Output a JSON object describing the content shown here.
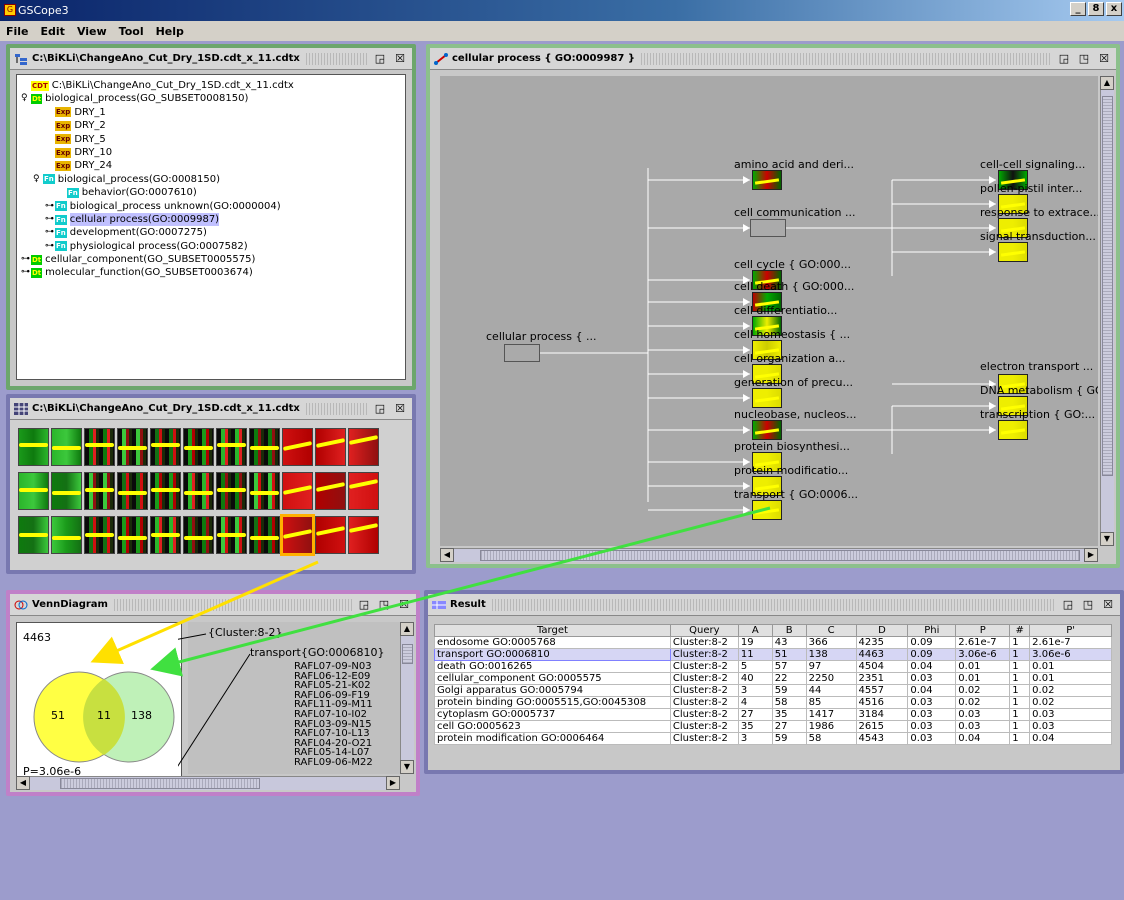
{
  "app": {
    "title": "GSCope3",
    "window_buttons": [
      "_",
      "8",
      "x"
    ]
  },
  "menu": [
    "File",
    "Edit",
    "View",
    "Tool",
    "Help"
  ],
  "tree_window": {
    "title": "C:\\BiKLi\\ChangeAno_Cut_Dry_1SD.cdt_x_11.cdtx",
    "nodes": [
      {
        "tag": "cdt",
        "tag_text": "CDT",
        "label": "C:\\BiKLi\\ChangeAno_Cut_Dry_1SD.cdt_x_11.cdtx",
        "indent": 0,
        "toggle": ""
      },
      {
        "tag": "dt",
        "tag_text": "Dt",
        "label": "biological_process(GO_SUBSET0008150)",
        "indent": 0,
        "toggle": "o"
      },
      {
        "tag": "exp",
        "tag_text": "Exp",
        "label": "DRY_1",
        "indent": 2,
        "toggle": ""
      },
      {
        "tag": "exp",
        "tag_text": "Exp",
        "label": "DRY_2",
        "indent": 2,
        "toggle": ""
      },
      {
        "tag": "exp",
        "tag_text": "Exp",
        "label": "DRY_5",
        "indent": 2,
        "toggle": ""
      },
      {
        "tag": "exp",
        "tag_text": "Exp",
        "label": "DRY_10",
        "indent": 2,
        "toggle": ""
      },
      {
        "tag": "exp",
        "tag_text": "Exp",
        "label": "DRY_24",
        "indent": 2,
        "toggle": ""
      },
      {
        "tag": "fn",
        "tag_text": "Fn",
        "label": "biological_process(GO:0008150)",
        "indent": 1,
        "toggle": "o"
      },
      {
        "tag": "fn",
        "tag_text": "Fn",
        "label": "behavior(GO:0007610)",
        "indent": 3,
        "toggle": ""
      },
      {
        "tag": "fn",
        "tag_text": "Fn",
        "label": "biological_process unknown(GO:0000004)",
        "indent": 2,
        "toggle": "o-"
      },
      {
        "tag": "fn",
        "tag_text": "Fn",
        "label": "cellular process(GO:0009987)",
        "indent": 2,
        "toggle": "o-",
        "selected": true
      },
      {
        "tag": "fn",
        "tag_text": "Fn",
        "label": "development(GO:0007275)",
        "indent": 2,
        "toggle": "o-"
      },
      {
        "tag": "fn",
        "tag_text": "Fn",
        "label": "physiological process(GO:0007582)",
        "indent": 2,
        "toggle": "o-"
      },
      {
        "tag": "dt",
        "tag_text": "Dt",
        "label": "cellular_component(GO_SUBSET0005575)",
        "indent": 0,
        "toggle": "o-"
      },
      {
        "tag": "dt",
        "tag_text": "Dt",
        "label": "molecular_function(GO_SUBSET0003674)",
        "indent": 0,
        "toggle": "o-"
      }
    ]
  },
  "cluster_window": {
    "title": "C:\\BiKLi\\ChangeAno_Cut_Dry_1SD.cdt_x_11.cdtx"
  },
  "graph_window": {
    "title": "cellular process { GO:0009987 }",
    "root_label": "cellular process { ...",
    "level1": [
      "amino acid and deri...",
      "cell communication ...",
      "cell cycle { GO:000...",
      "cell death { GO:000...",
      "cell differentiatio...",
      "cell homeostasis { ...",
      "cell organization a...",
      "generation of precu...",
      "nucleobase, nucleos...",
      "protein biosynthesi...",
      "protein modificatio...",
      "transport { GO:0006..."
    ],
    "level2_comm": [
      "cell-cell signaling...",
      "pollen-pistil inter...",
      "response to extrace...",
      "signal transduction..."
    ],
    "level2_nucleo": [
      "electron transport ...",
      "DNA metabolism { GO",
      "transcription { GO:..."
    ]
  },
  "venn_window": {
    "title": "VennDiagram",
    "total": "4463",
    "left_only": "51",
    "overlap": "11",
    "right_only": "138",
    "pvalue": "P=3.06e-6",
    "label_cluster": "{Cluster:8-2}",
    "label_transport": "transport{GO:0006810}",
    "genes": [
      "RAFL07-09-N03",
      "RAFL06-12-E09",
      "RAFL05-21-K02",
      "RAFL06-09-F19",
      "RAFL11-09-M11",
      "RAFL07-10-I02",
      "RAFL03-09-N15",
      "RAFL07-10-L13",
      "RAFL04-20-O21",
      "RAFL05-14-L07",
      "RAFL09-06-M22"
    ]
  },
  "result_window": {
    "title": "Result",
    "columns": [
      "Target",
      "Query",
      "A",
      "B",
      "C",
      "D",
      "Phi",
      "P",
      "#",
      "P'"
    ],
    "rows": [
      [
        "endosome GO:0005768",
        "Cluster:8-2",
        "19",
        "43",
        "366",
        "4235",
        "0.09",
        "2.61e-7",
        "1",
        "2.61e-7"
      ],
      [
        "transport GO:0006810",
        "Cluster:8-2",
        "11",
        "51",
        "138",
        "4463",
        "0.09",
        "3.06e-6",
        "1",
        "3.06e-6"
      ],
      [
        "death GO:0016265",
        "Cluster:8-2",
        "5",
        "57",
        "97",
        "4504",
        "0.04",
        "0.01",
        "1",
        "0.01"
      ],
      [
        "cellular_component GO:0005575",
        "Cluster:8-2",
        "40",
        "22",
        "2250",
        "2351",
        "0.03",
        "0.01",
        "1",
        "0.01"
      ],
      [
        "Golgi apparatus GO:0005794",
        "Cluster:8-2",
        "3",
        "59",
        "44",
        "4557",
        "0.04",
        "0.02",
        "1",
        "0.02"
      ],
      [
        "protein binding GO:0005515,GO:0045308",
        "Cluster:8-2",
        "4",
        "58",
        "85",
        "4516",
        "0.03",
        "0.02",
        "1",
        "0.02"
      ],
      [
        "cytoplasm GO:0005737",
        "Cluster:8-2",
        "27",
        "35",
        "1417",
        "3184",
        "0.03",
        "0.03",
        "1",
        "0.03"
      ],
      [
        "cell GO:0005623",
        "Cluster:8-2",
        "35",
        "27",
        "1986",
        "2615",
        "0.03",
        "0.03",
        "1",
        "0.03"
      ],
      [
        "protein modification GO:0006464",
        "Cluster:8-2",
        "3",
        "59",
        "58",
        "4543",
        "0.03",
        "0.04",
        "1",
        "0.04"
      ]
    ],
    "highlight_row": 1
  },
  "colors": {
    "tree_frame": "#6ca66c",
    "graph_frame": "#8cc08c",
    "cluster_frame": "#7878b0",
    "venn_frame": "#c080c8",
    "result_frame": "#7878b0",
    "desktop": "#9c9ccc",
    "yellow_arrow": "#ffe000",
    "green_arrow": "#40e040"
  },
  "icons": {
    "restore": "restore-icon",
    "maximize": "maximize-icon",
    "close": "close-icon"
  }
}
